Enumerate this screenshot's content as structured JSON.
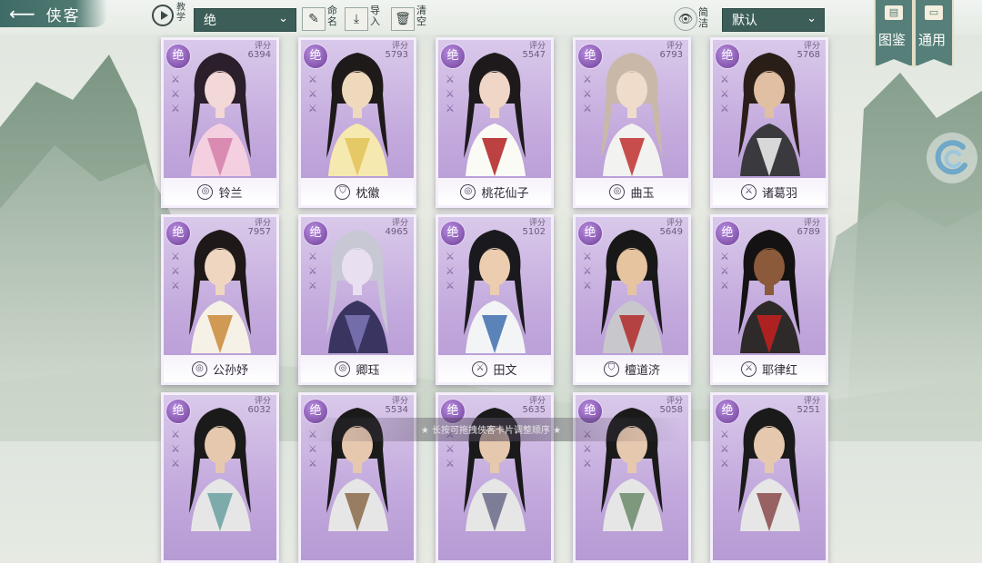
{
  "header": {
    "back_title": "侠客",
    "tutorial_label": "教学",
    "filter_value": "绝",
    "tool_naming": "命名",
    "tool_import": "导入",
    "tool_clear": "清空",
    "concise_label": "简洁",
    "sort_value": "默认",
    "banner_atlas": "图鉴",
    "banner_general": "通用"
  },
  "score_label": "评分",
  "grade_label": "绝",
  "cards": [
    {
      "name": "铃兰",
      "score": "6394",
      "faction": "swirl-icon",
      "palette": [
        "#2a1f2a",
        "#f4cfe0",
        "#f2d8d6",
        "#d47fa8"
      ]
    },
    {
      "name": "枕徽",
      "score": "5793",
      "faction": "shield-icon",
      "palette": [
        "#1f1a1a",
        "#f6e9b0",
        "#efd9bc",
        "#e3c35a"
      ]
    },
    {
      "name": "桃花仙子",
      "score": "5547",
      "faction": "swirl-icon",
      "palette": [
        "#1e1a1c",
        "#fbfbf6",
        "#f0d6c6",
        "#b02020"
      ]
    },
    {
      "name": "曲玉",
      "score": "6793",
      "faction": "swirl-icon",
      "palette": [
        "#c9b8a8",
        "#f2f2f0",
        "#f0dccb",
        "#c03030"
      ]
    },
    {
      "name": "诸葛羽",
      "score": "5768",
      "faction": "sword-icon",
      "palette": [
        "#2a1e18",
        "#3a3a3e",
        "#e0bfa2",
        "#f4f4f4"
      ]
    },
    {
      "name": "公孙妤",
      "score": "7957",
      "faction": "swirl-icon",
      "palette": [
        "#1e1818",
        "#f6f1e6",
        "#efd6c0",
        "#c98b3a"
      ]
    },
    {
      "name": "卿珏",
      "score": "4965",
      "faction": "swirl-icon",
      "palette": [
        "#c8c8d4",
        "#3a3560",
        "#e8e0f0",
        "#7f77b8"
      ]
    },
    {
      "name": "田文",
      "score": "5102",
      "faction": "sword-icon",
      "palette": [
        "#1a1a1e",
        "#f2f4f6",
        "#eccdb0",
        "#3e6fae"
      ]
    },
    {
      "name": "檀道济",
      "score": "5649",
      "faction": "shield-icon",
      "palette": [
        "#181818",
        "#c8c8cc",
        "#e6c4a0",
        "#b02a2a"
      ]
    },
    {
      "name": "耶律红",
      "score": "6789",
      "faction": "sword-icon",
      "palette": [
        "#141212",
        "#2e2a2a",
        "#8a5a3a",
        "#c42020"
      ]
    },
    {
      "name": "",
      "score": "6032",
      "faction": "",
      "palette": [
        "#1a1a1a",
        "#e6e6e6",
        "#e6c8ae",
        "#6aa0a0"
      ]
    },
    {
      "name": "",
      "score": "5534",
      "faction": "",
      "palette": [
        "#1a1a1a",
        "#e6e6e6",
        "#e6c8ae",
        "#8a6a4a"
      ]
    },
    {
      "name": "",
      "score": "5635",
      "faction": "",
      "palette": [
        "#1a1a1a",
        "#e6e6e6",
        "#e6c8ae",
        "#6a6a8a"
      ]
    },
    {
      "name": "",
      "score": "5058",
      "faction": "",
      "palette": [
        "#1a1a1a",
        "#e6e6e6",
        "#e6c8ae",
        "#6a8a6a"
      ]
    },
    {
      "name": "",
      "score": "5251",
      "faction": "",
      "palette": [
        "#1a1a1a",
        "#e6e6e6",
        "#e6c8ae",
        "#8a4a4a"
      ]
    }
  ],
  "footer_hint": "★ 长按可拖拽侠客卡片调整顺序 ★",
  "colors": {
    "teal": "#3d5e58",
    "purple_card": "#c2a8dc",
    "grade": "#6e3e98"
  }
}
